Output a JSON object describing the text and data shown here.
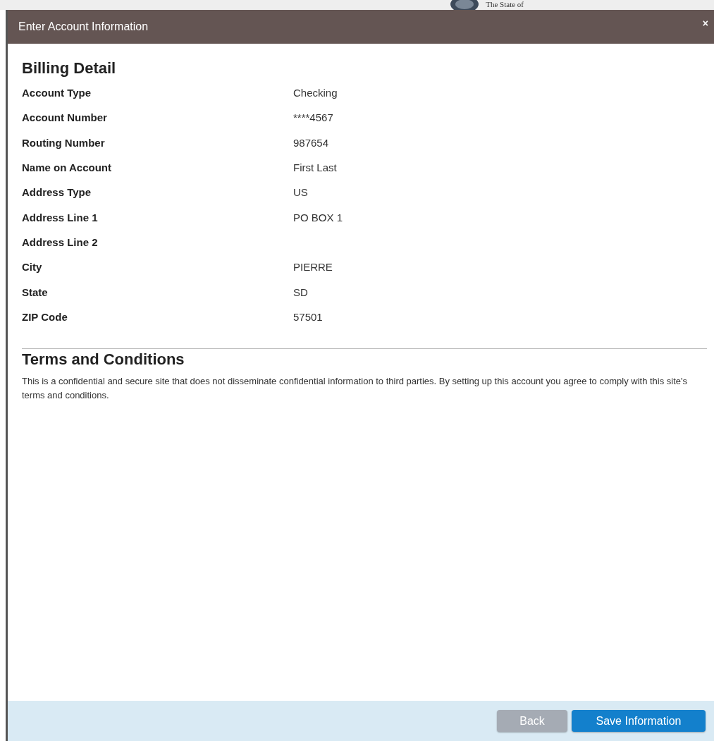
{
  "backdrop": {
    "seal_caption": "The State of"
  },
  "dialog": {
    "title": "Enter Account Information",
    "close": "×"
  },
  "billing": {
    "heading": "Billing Detail",
    "rows": [
      {
        "label": "Account Type",
        "value": "Checking"
      },
      {
        "label": "Account Number",
        "value": "****4567"
      },
      {
        "label": "Routing Number",
        "value": "987654"
      },
      {
        "label": "Name on Account",
        "value": "First Last"
      },
      {
        "label": "Address Type",
        "value": "US"
      },
      {
        "label": "Address Line 1",
        "value": "PO BOX 1"
      },
      {
        "label": "Address Line 2"
      },
      {
        "label": "City",
        "value": "PIERRE"
      },
      {
        "label": "State",
        "value": "SD"
      },
      {
        "label": "ZIP Code",
        "value": "57501"
      }
    ]
  },
  "terms": {
    "heading": "Terms and Conditions",
    "text": "This is a confidential and secure site that does not disseminate confidential information to third parties. By setting up this account you agree to comply with this site's terms and conditions."
  },
  "buttons": [
    {
      "label": "Back",
      "kind": "secondary"
    },
    {
      "label": "Save Information",
      "kind": "primary"
    }
  ]
}
